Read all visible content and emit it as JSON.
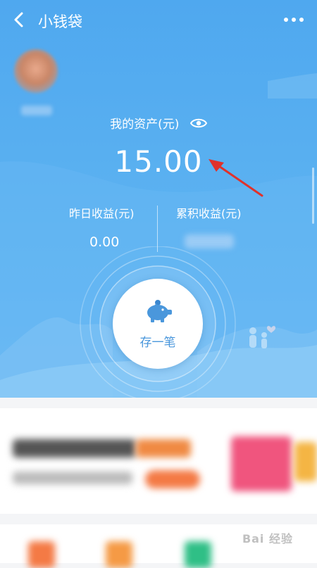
{
  "header": {
    "title": "小钱袋",
    "back_icon": "back-arrow-icon",
    "more_icon": "more-dots-icon"
  },
  "asset": {
    "label": "我的资产(元)",
    "amount": "15.00"
  },
  "stats": {
    "yesterday_label": "昨日收益(元)",
    "yesterday_value": "0.00",
    "total_label": "累积收益(元)"
  },
  "save_button": {
    "label": "存一笔",
    "icon": "piggy-bank-icon"
  },
  "colors": {
    "primary": "#4fa8ef",
    "button_text": "#4a97dc",
    "arrow": "#e0322b"
  },
  "watermark": {
    "text": "Bai 经验"
  }
}
